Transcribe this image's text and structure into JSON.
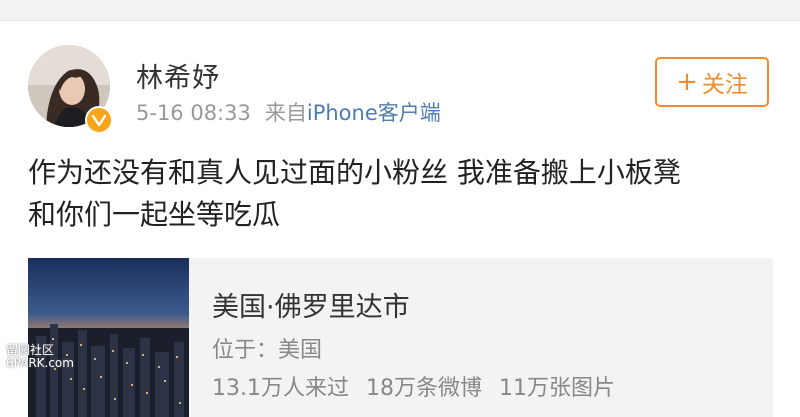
{
  "post": {
    "username": "林希妤",
    "time": "5-16 08:33",
    "source_prefix": "来自",
    "source_device": "iPhone客户端",
    "follow_label": "关注",
    "follow_plus": "+",
    "text_lines": [
      "作为还没有和真人见过面的小粉丝 我准备搬上小板凳",
      "和你们一起坐等吃瓜"
    ]
  },
  "location_card": {
    "title": "美国·佛罗里达市",
    "subtitle": "位于：美国",
    "stats": [
      "13.1万人来过",
      "18万条微博",
      "11万张图片"
    ]
  },
  "watermark": {
    "line1": "留园社区",
    "line2": "6PARK.com"
  },
  "colors": {
    "accent_orange": "#f08c2b",
    "link_blue": "#507daf",
    "badge_yellow": "#f8a51b"
  },
  "icons": {
    "verified": "verified-v-badge-icon"
  }
}
